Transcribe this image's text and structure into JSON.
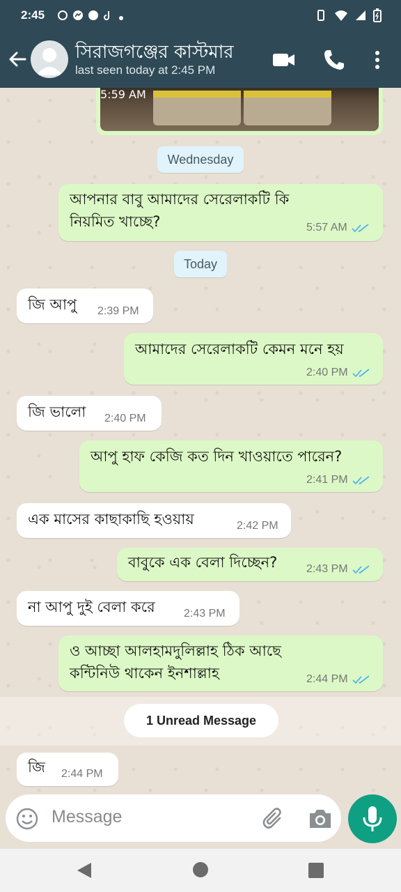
{
  "status_bar": {
    "time": "2:45"
  },
  "header": {
    "contact_name": "সিরাজগঞ্জের কাস্টমার",
    "last_seen": "last seen today at 2:45 PM"
  },
  "chat": {
    "image_time": "5:59 AM",
    "day_wednesday": "Wednesday",
    "day_today": "Today",
    "unread": "1 Unread Message",
    "messages": [
      {
        "dir": "out",
        "text": [
          "আপনার বাবু আমাদের সেরেলাকটি কি",
          "নিয়মিত খাচ্ছে?"
        ],
        "time": "5:57 AM"
      },
      {
        "dir": "in",
        "text": [
          "জি আপু"
        ],
        "time": "2:39 PM"
      },
      {
        "dir": "out",
        "text": [
          "আমাদের সেরেলাকটি কেমন মনে হয়"
        ],
        "time": "2:40 PM"
      },
      {
        "dir": "in",
        "text": [
          "জি ভালো"
        ],
        "time": "2:40 PM"
      },
      {
        "dir": "out",
        "text": [
          "আপু হাফ কেজি কত দিন খাওয়াতে পারেন?"
        ],
        "time": "2:41 PM"
      },
      {
        "dir": "in",
        "text": [
          "এক মাসের কাছাকাছি হওয়ায়"
        ],
        "time": "2:42 PM"
      },
      {
        "dir": "out",
        "text": [
          "বাবুকে এক বেলা দিচ্ছেন?"
        ],
        "time": "2:43 PM"
      },
      {
        "dir": "in",
        "text": [
          "না আপু দুই বেলা করে"
        ],
        "time": "2:43 PM"
      },
      {
        "dir": "out",
        "text": [
          "ও আচ্ছা আলহামদুলিল্লাহ ঠিক আছে",
          "কন্টিনিউ থাকেন ইনশাল্লাহ"
        ],
        "time": "2:44 PM"
      },
      {
        "dir": "in",
        "text": [
          "জি"
        ],
        "time": "2:44 PM"
      }
    ]
  },
  "input": {
    "placeholder": "Message"
  },
  "colors": {
    "header": "#2f4a56",
    "outgoing": "#dcf8c6",
    "incoming": "#ffffff",
    "accent": "#0f9f82",
    "read_ticks": "#4fb6ec"
  },
  "icons": {
    "back": "arrow-left-icon",
    "video": "video-call-icon",
    "phone": "phone-icon",
    "menu": "more-vertical-icon",
    "emoji": "emoji-icon",
    "attach": "paperclip-icon",
    "camera": "camera-icon",
    "mic": "microphone-icon"
  }
}
